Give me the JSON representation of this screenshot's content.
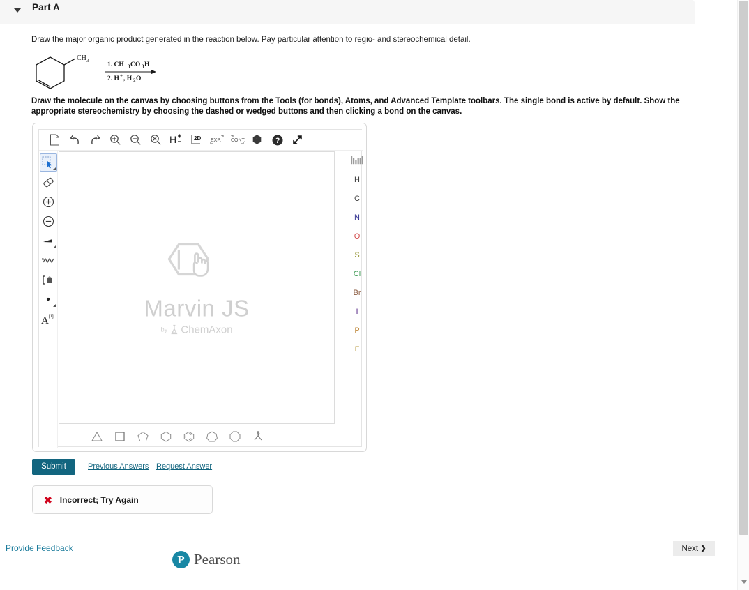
{
  "part": {
    "title": "Part A",
    "toggle_icon": "caret-down-icon"
  },
  "prompts": {
    "question": "Draw the major organic product generated in the reaction below. Pay particular attention to regio- and stereochemical detail.",
    "instructions": "Draw the molecule on the canvas by choosing buttons from the Tools (for bonds), Atoms, and Advanced Template toolbars. The single bond is active by default. Show the appropriate stereochemistry by choosing the dashed or wedged buttons and then clicking a bond on the canvas."
  },
  "reaction": {
    "substrate_label": "CH3",
    "substrate_name": "1-methylcyclohexene",
    "reagent_line_1": "1. CH3CO3H",
    "reagent_line_2": "2. H+, H2O"
  },
  "editor": {
    "watermark_title": "Marvin JS",
    "watermark_by": "by",
    "watermark_vendor": "ChemAxon",
    "top_toolbar": [
      {
        "name": "new-file-icon",
        "title": "Clear"
      },
      {
        "name": "undo-icon",
        "title": "Undo"
      },
      {
        "name": "redo-icon",
        "title": "Redo"
      },
      {
        "name": "zoom-in-icon",
        "title": "Zoom in"
      },
      {
        "name": "zoom-out-icon",
        "title": "Zoom out"
      },
      {
        "name": "zoom-reset-icon",
        "title": "Zoom to fit"
      },
      {
        "name": "hydrogen-toggle-icon",
        "title": "Add/Remove explicit hydrogens",
        "label": "H"
      },
      {
        "name": "clean-2d-icon",
        "title": "Structure clean 2D",
        "label": "2D"
      },
      {
        "name": "expand-group-icon",
        "title": "Expand group",
        "label": "EXP."
      },
      {
        "name": "contract-group-icon",
        "title": "Contract group",
        "label": "CONT."
      },
      {
        "name": "info-icon",
        "title": "About"
      },
      {
        "name": "help-icon",
        "title": "Help"
      },
      {
        "name": "fullscreen-icon",
        "title": "Fullscreen"
      }
    ],
    "left_tools": [
      {
        "name": "selection-tool-icon",
        "title": "Selection",
        "selected": true
      },
      {
        "name": "eraser-tool-icon",
        "title": "Erase",
        "selected": false
      },
      {
        "name": "increase-charge-icon",
        "title": "Increase charge",
        "selected": false
      },
      {
        "name": "decrease-charge-icon",
        "title": "Decrease charge",
        "selected": false
      },
      {
        "name": "bond-tool-icon",
        "title": "Single bond",
        "selected": false
      },
      {
        "name": "chain-tool-icon",
        "title": "Chain",
        "selected": false
      },
      {
        "name": "bracket-tool-icon",
        "title": "Bracket",
        "selected": false
      },
      {
        "name": "radical-tool-icon",
        "title": "Radical / electron",
        "selected": false
      },
      {
        "name": "atom-label-tool-icon",
        "title": "Atom label",
        "label": "A",
        "sup": "[1]",
        "selected": false
      }
    ],
    "atoms": [
      {
        "symbol": "",
        "name": "periodic-table-icon",
        "color": "#888888"
      },
      {
        "symbol": "H",
        "name": "atom-h",
        "color": "#3c3c3c"
      },
      {
        "symbol": "C",
        "name": "atom-c",
        "color": "#3c3c3c"
      },
      {
        "symbol": "N",
        "name": "atom-n",
        "color": "#2a2a8c"
      },
      {
        "symbol": "O",
        "name": "atom-o",
        "color": "#d24b4b"
      },
      {
        "symbol": "S",
        "name": "atom-s",
        "color": "#9b9b3f"
      },
      {
        "symbol": "Cl",
        "name": "atom-cl",
        "color": "#3f9b56"
      },
      {
        "symbol": "Br",
        "name": "atom-br",
        "color": "#8a5a3f"
      },
      {
        "symbol": "I",
        "name": "atom-i",
        "color": "#5b2f8a"
      },
      {
        "symbol": "P",
        "name": "atom-p",
        "color": "#c08a3f"
      },
      {
        "symbol": "F",
        "name": "atom-f",
        "color": "#b89a3f"
      }
    ],
    "templates": [
      {
        "name": "template-cyclopropane",
        "sides": 3
      },
      {
        "name": "template-cyclobutane",
        "sides": 4
      },
      {
        "name": "template-cyclopentane",
        "sides": 5
      },
      {
        "name": "template-cyclohexane",
        "sides": 6
      },
      {
        "name": "template-benzene",
        "sides": 6
      },
      {
        "name": "template-cycloheptane",
        "sides": 7
      },
      {
        "name": "template-cyclooctane",
        "sides": 8
      },
      {
        "name": "template-advanced",
        "sides": 0
      }
    ]
  },
  "actions": {
    "submit_label": "Submit",
    "previous_answers_label": "Previous Answers",
    "request_answer_label": "Request Answer"
  },
  "feedback": {
    "icon": "incorrect-x-icon",
    "text": "Incorrect; Try Again",
    "color": "#d0021b"
  },
  "footer": {
    "provide_feedback_label": "Provide Feedback",
    "brand": "Pearson",
    "brand_mark": "P",
    "next_label": "Next",
    "next_chevron": "❯"
  },
  "theme": {
    "accent": "#12657f",
    "link": "#1c7c9c",
    "header_bg": "#f6f6f6",
    "error": "#d0021b"
  }
}
